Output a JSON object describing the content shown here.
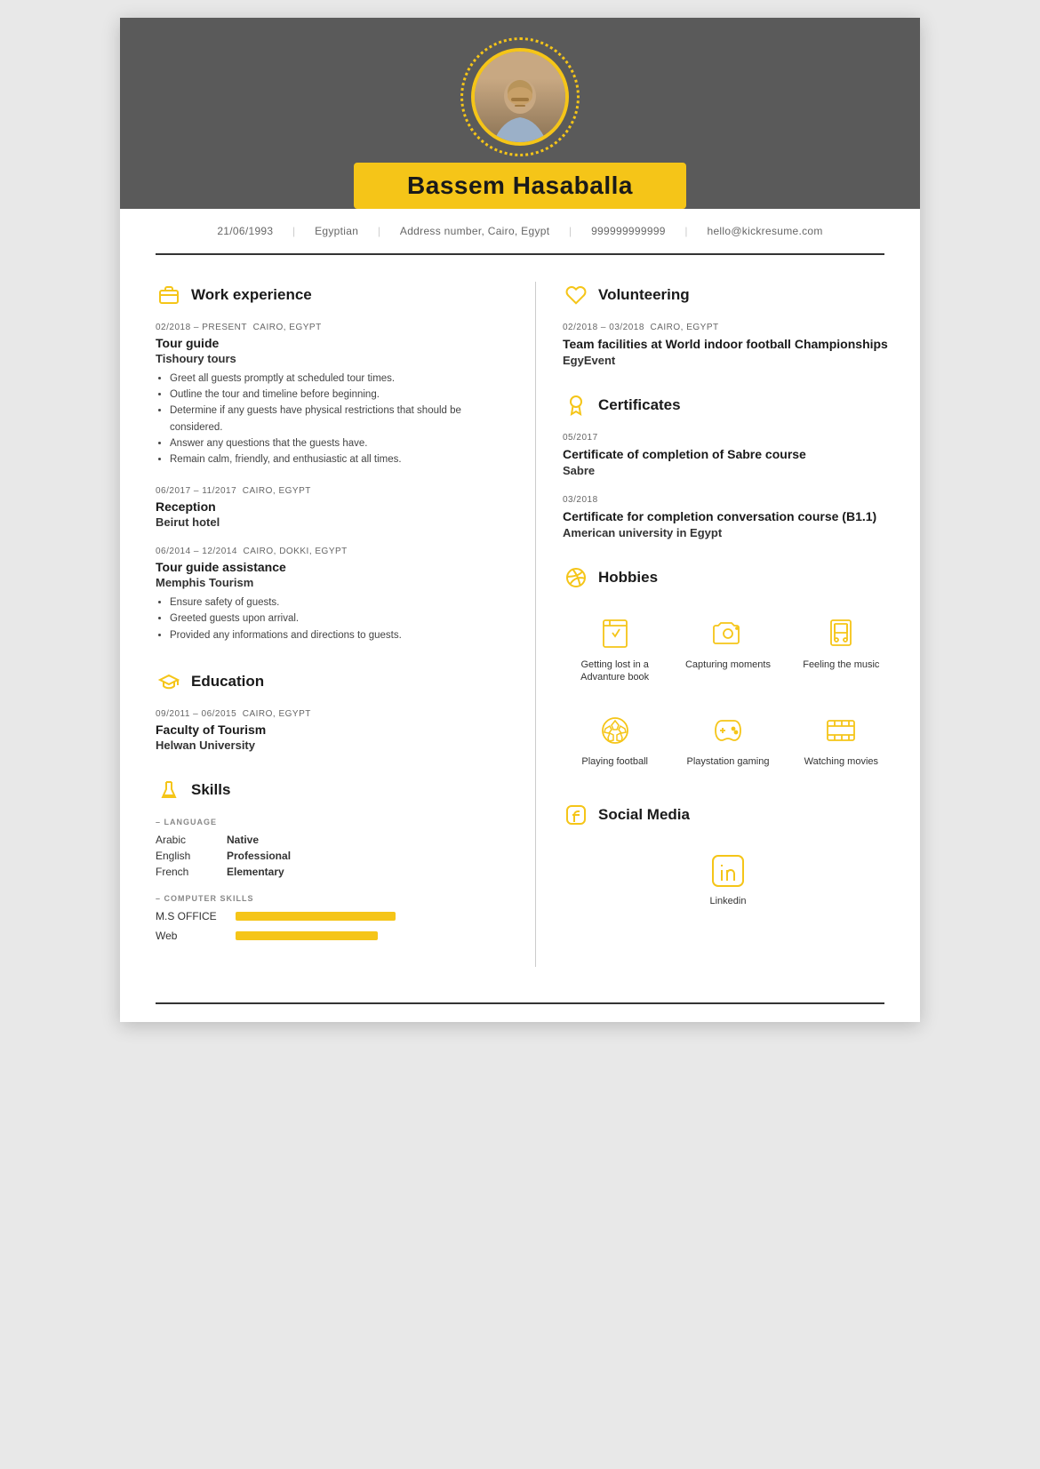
{
  "header": {
    "name": "Bassem Hasaballa",
    "dob": "21/06/1993",
    "nationality": "Egyptian",
    "address": "Address number, Cairo, Egypt",
    "phone": "999999999999",
    "email": "hello@kickresume.com"
  },
  "work_experience": {
    "section_title": "Work experience",
    "jobs": [
      {
        "date": "02/2018 – PRESENT",
        "location": "CAIRO, EGYPT",
        "title": "Tour guide",
        "company": "Tishoury tours",
        "bullets": [
          "Greet all guests promptly at scheduled tour times.",
          "Outline the tour and timeline before beginning.",
          "Determine if any guests have physical restrictions that should be considered.",
          "Answer any questions that the guests have.",
          "Remain calm, friendly, and enthusiastic at all times."
        ]
      },
      {
        "date": "06/2017 – 11/2017",
        "location": "CAIRO, EGYPT",
        "title": "Reception",
        "company": "Beirut hotel",
        "bullets": []
      },
      {
        "date": "06/2014 – 12/2014",
        "location": "CAIRO, DOKKI, EGYPT",
        "title": "Tour guide assistance",
        "company": "Memphis Tourism",
        "bullets": [
          "Ensure safety of guests.",
          "Greeted guests upon arrival.",
          "Provided any informations and directions to guests."
        ]
      }
    ]
  },
  "education": {
    "section_title": "Education",
    "items": [
      {
        "date": "09/2011 – 06/2015",
        "location": "CAIRO, EGYPT",
        "degree": "Faculty of Tourism",
        "school": "Helwan University"
      }
    ]
  },
  "skills": {
    "section_title": "Skills",
    "language_label": "– LANGUAGE",
    "languages": [
      {
        "name": "Arabic",
        "level": "Native"
      },
      {
        "name": "English",
        "level": "Professional"
      },
      {
        "name": "French",
        "level": "Elementary"
      }
    ],
    "computer_label": "– COMPUTER SKILLS",
    "computer_skills": [
      {
        "name": "M.S OFFICE",
        "width": 180
      },
      {
        "name": "Web",
        "width": 160
      }
    ]
  },
  "volunteering": {
    "section_title": "Volunteering",
    "items": [
      {
        "date": "02/2018 – 03/2018",
        "location": "CAIRO, EGYPT",
        "title": "Team facilities at World indoor football Championships",
        "org": "EgyEvent"
      }
    ]
  },
  "certificates": {
    "section_title": "Certificates",
    "items": [
      {
        "date": "05/2017",
        "title": "Certificate of completion of Sabre course",
        "org": "Sabre"
      },
      {
        "date": "03/2018",
        "title": "Certificate for completion conversation course (B1.1)",
        "org": "American university in Egypt"
      }
    ]
  },
  "hobbies": {
    "section_title": "Hobbies",
    "items": [
      {
        "label": "Getting lost in a Advanture book",
        "icon": "book"
      },
      {
        "label": "Capturing moments",
        "icon": "camera"
      },
      {
        "label": "Feeling the music",
        "icon": "music"
      },
      {
        "label": "Playing football",
        "icon": "football"
      },
      {
        "label": "Playstation gaming",
        "icon": "gamepad"
      },
      {
        "label": "Watching movies",
        "icon": "movie"
      }
    ]
  },
  "social_media": {
    "section_title": "Social Media",
    "items": [
      {
        "label": "Linkedin",
        "icon": "linkedin"
      }
    ]
  }
}
